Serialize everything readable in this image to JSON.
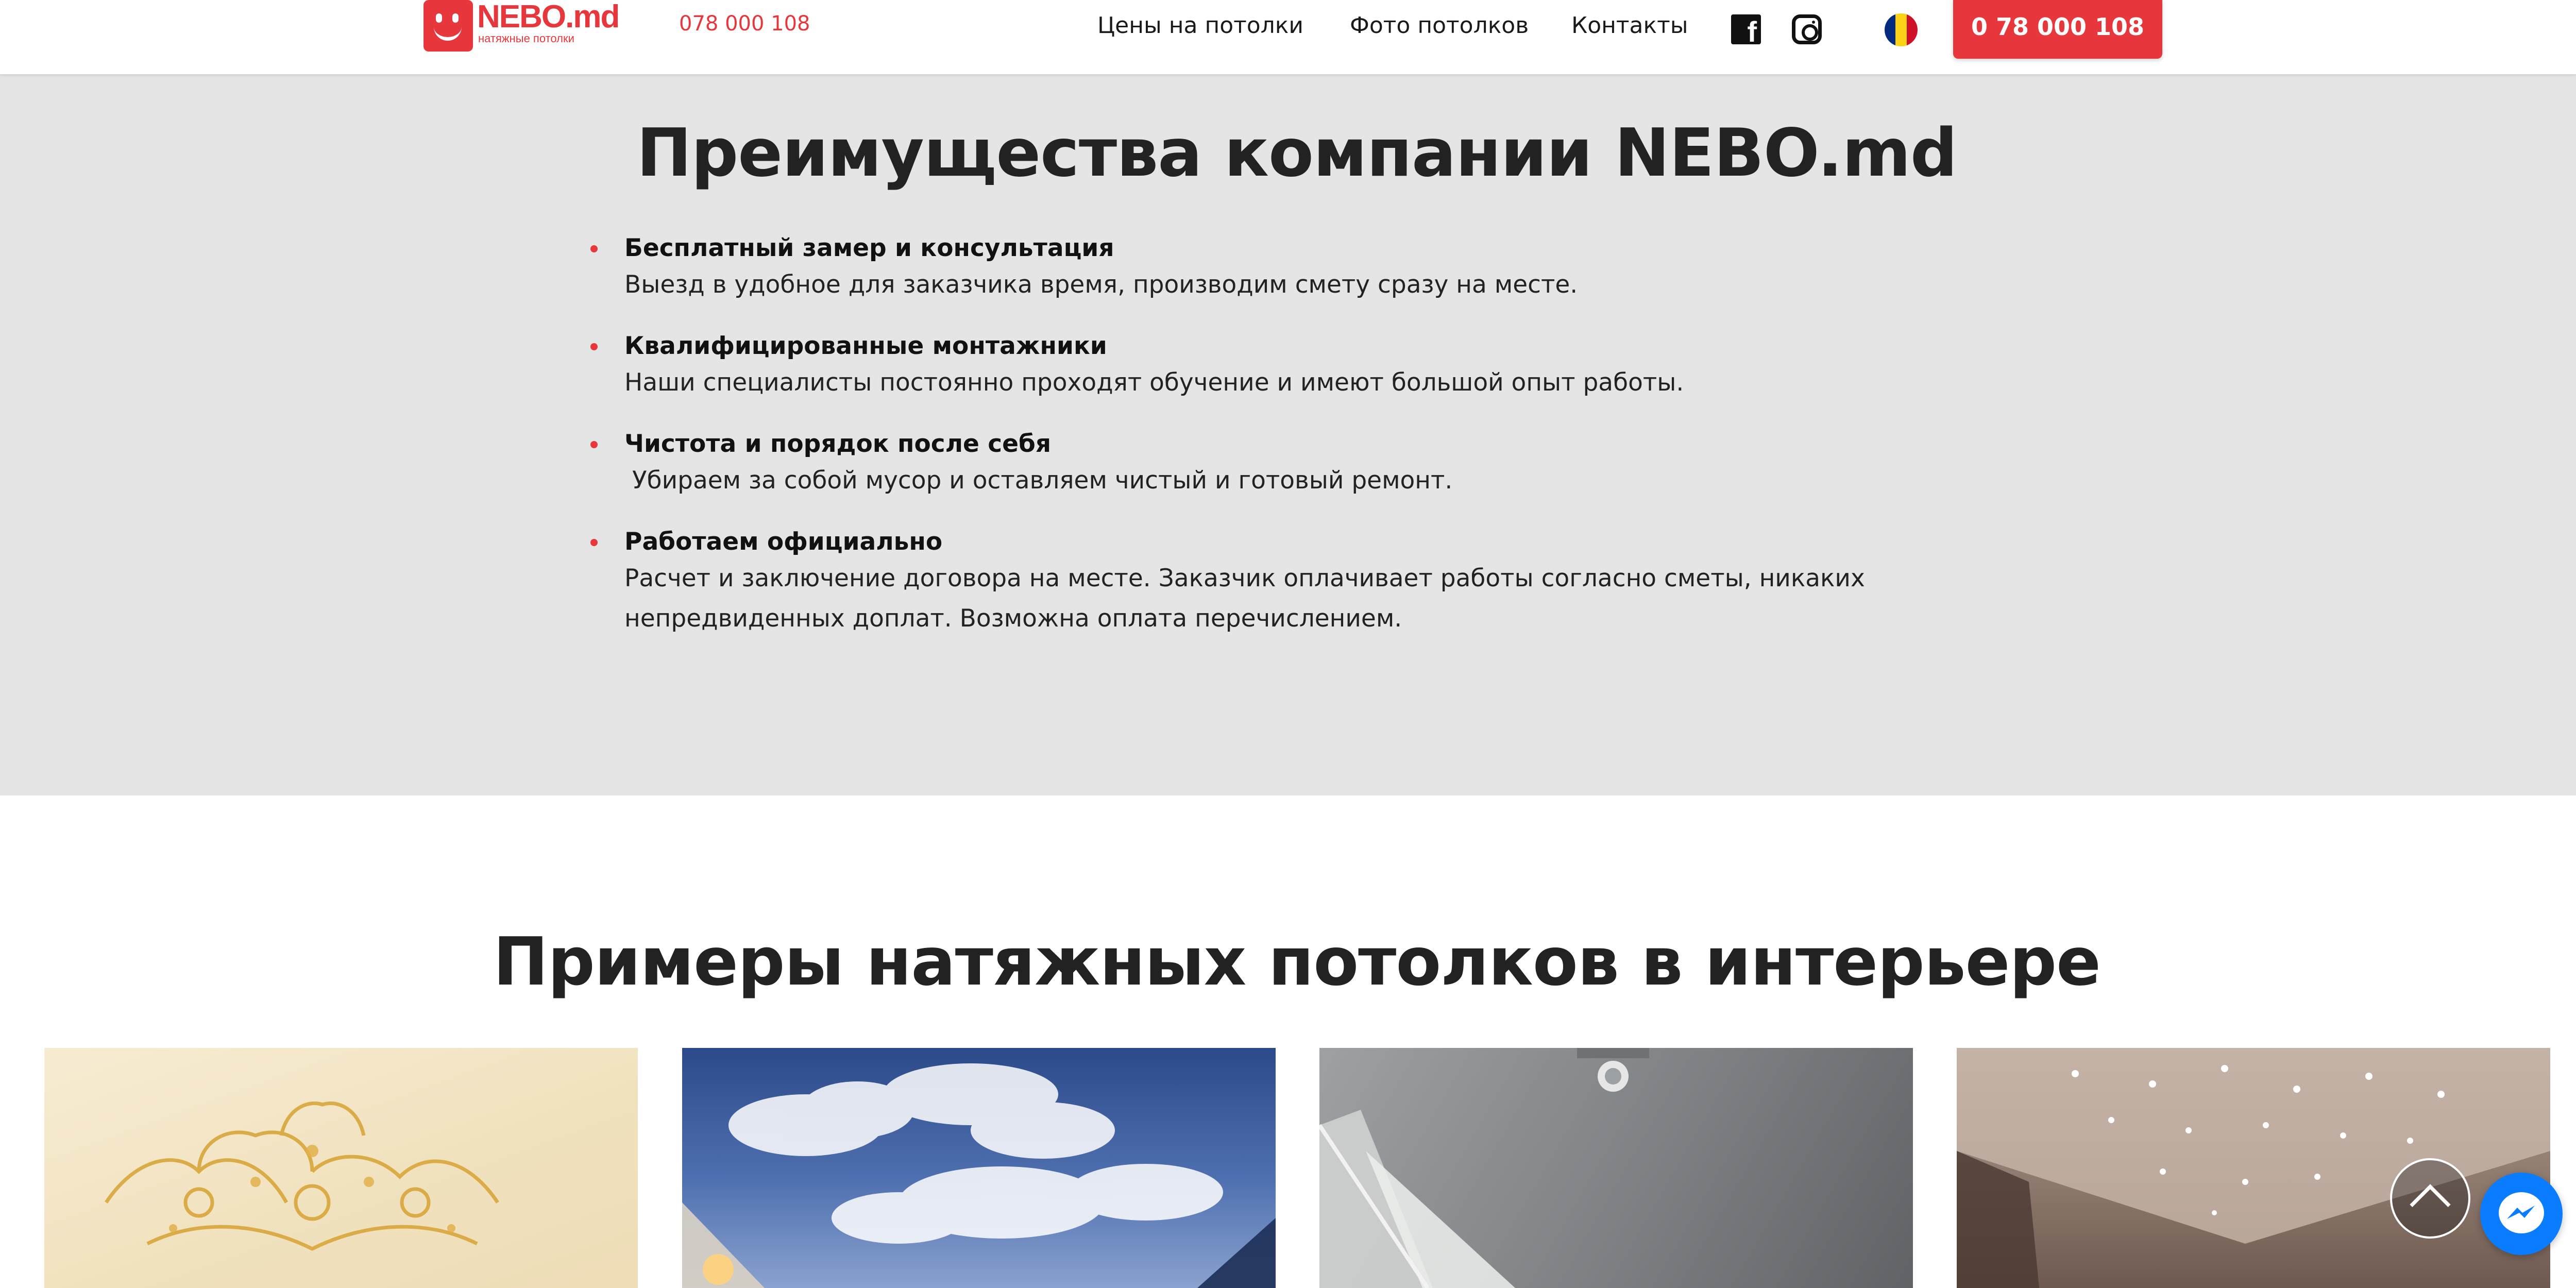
{
  "header": {
    "logo": {
      "name": "NEBO.md",
      "subtitle": "натяжные потолки"
    },
    "phone": "078 000 108",
    "nav": [
      "Цены на потолки",
      "Фото потолков",
      "Контакты"
    ],
    "social": [
      "facebook-icon",
      "instagram-icon"
    ],
    "language_flag": {
      "country": "Romania",
      "colors": [
        "#002b7f",
        "#fcd116",
        "#ce1126"
      ]
    },
    "cta_phone": "0 78 000 108"
  },
  "advantages": {
    "title": "Преимущества компании NEBO.md",
    "items": [
      {
        "heading": "Бесплатный замер и консультация",
        "text": "Выезд в удобное для заказчика время, производим смету сразу на месте."
      },
      {
        "heading": "Квалифицированные монтажники",
        "text": "Наши специалисты постоянно проходят обучение и имеют большой опыт работы."
      },
      {
        "heading": "Чистота и порядок после себя",
        "text": " Убираем за собой мусор и оставляем чистый и готовый ремонт."
      },
      {
        "heading": "Работаем официально",
        "text": "Расчет и заключение договора на месте. Заказчик оплачивает работы согласно сметы, никаких непредвиденных доплат. Возможна оплата перечислением."
      }
    ]
  },
  "examples": {
    "title": "Примеры натяжных потолков в интерьере",
    "images": [
      "gold ornament ceiling",
      "sky clouds print ceiling",
      "grey glossy ceiling with spotlight",
      "ceiling with star lights"
    ]
  },
  "colors": {
    "accent": "#e8363d",
    "section_bg": "#e5e5e5",
    "messenger": "#0a7cff"
  }
}
